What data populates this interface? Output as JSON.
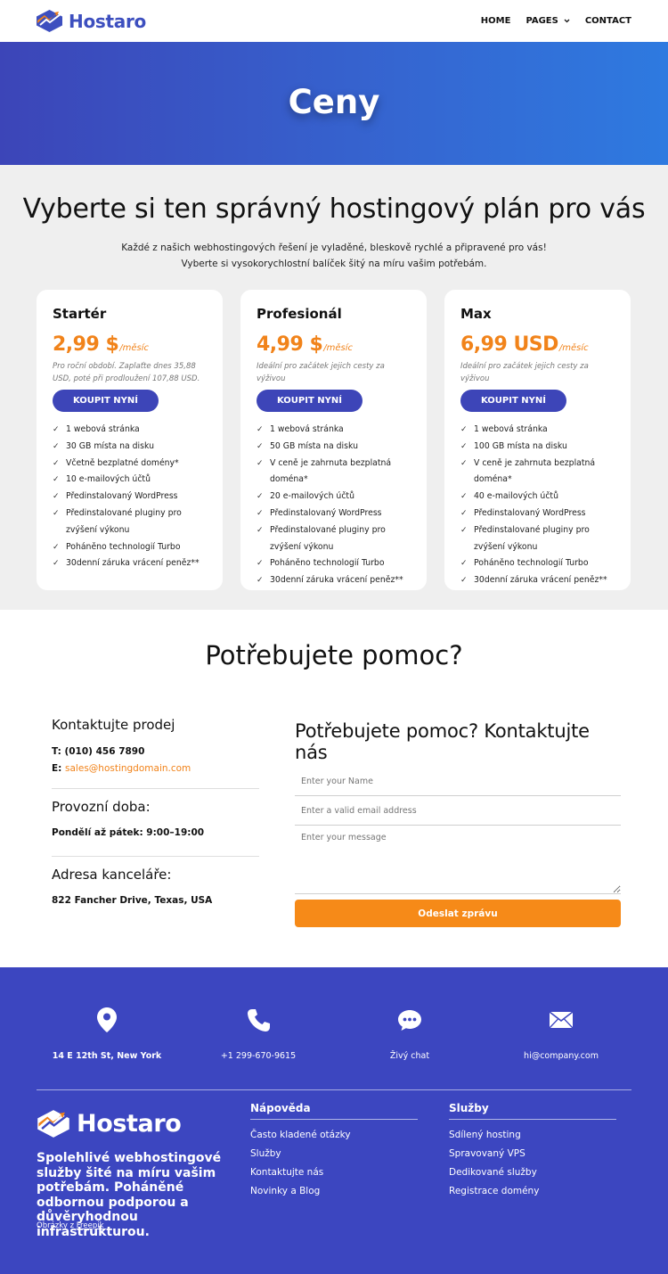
{
  "header": {
    "brand": "Hostaro",
    "nav": [
      "HOME",
      "PAGES",
      "CONTACT"
    ]
  },
  "hero": {
    "title": "Ceny"
  },
  "pricing": {
    "title": "Vyberte si ten správný hostingový plán pro vás",
    "intro_line1": "Každé z našich webhostingových řešení je vyladěné, bleskově rychlé a připravené pro vás!",
    "intro_line2": "Vyberte si vysokorychlostní balíček šitý na míru vašim potřebám.",
    "plans": [
      {
        "name": "Startér",
        "price": "2,99 $",
        "per": "/měsíc",
        "note": "Pro roční období. Zaplaťte dnes 35,88 USD, poté při prodloužení 107,88 USD.",
        "button": "KOUPIT NYNÍ",
        "features": [
          "1 webová stránka",
          "30 GB místa na disku",
          "Včetně bezplatné domény*",
          "10 e-mailových účtů",
          "Předinstalovaný WordPress",
          "Předinstalované pluginy pro zvýšení výkonu",
          "Poháněno technologií Turbo",
          "30denní záruka vrácení peněz**"
        ]
      },
      {
        "name": "Profesionál",
        "price": "4,99 $",
        "per": "/měsíc",
        "note": "Ideální pro začátek jejich cesty za výživou",
        "button": "KOUPIT NYNÍ",
        "features": [
          "1 webová stránka",
          "50 GB místa na disku",
          "V ceně je zahrnuta bezplatná doména*",
          "20 e-mailových účtů",
          "Předinstalovaný WordPress",
          "Předinstalované pluginy pro zvýšení výkonu",
          "Poháněno technologií Turbo",
          "30denní záruka vrácení peněz**"
        ]
      },
      {
        "name": "Max",
        "price": "6,99 USD",
        "per": "/měsíc",
        "note": "Ideální pro začátek jejich cesty za výživou",
        "button": "KOUPIT NYNÍ",
        "features": [
          "1 webová stránka",
          "100 GB místa na disku",
          "V ceně je zahrnuta bezplatná doména*",
          "40 e-mailových účtů",
          "Předinstalovaný WordPress",
          "Předinstalované pluginy pro zvýšení výkonu",
          "Poháněno technologií Turbo",
          "30denní záruka vrácení peněz**"
        ]
      }
    ]
  },
  "help": {
    "title": "Potřebujete pomoc?",
    "sales_heading": "Kontaktujte prodej",
    "phone_label": "T:",
    "phone": "(010) 456 7890",
    "email_label": "E:",
    "email": "sales@hostingdomain.com",
    "hours_heading": "Provozní doba:",
    "hours": "Pondělí až pátek: 9:00–19:00",
    "address_heading": "Adresa kanceláře:",
    "address": "822 Fancher Drive, Texas, USA",
    "form_title": "Potřebujete pomoc? Kontaktujte nás",
    "name_placeholder": "Enter your Name",
    "email_placeholder": "Enter a valid email address",
    "message_placeholder": "Enter your message",
    "send": "Odeslat zprávu"
  },
  "footer": {
    "contacts": [
      {
        "icon": "location-pin-icon",
        "text": "14 E 12th St, New York"
      },
      {
        "icon": "phone-icon",
        "text": "+1 299-670-9615"
      },
      {
        "icon": "chat-icon",
        "text": "Živý chat"
      },
      {
        "icon": "mail-icon",
        "text": "hi@company.com"
      }
    ],
    "brand": "Hostaro",
    "tagline": "Spolehlivé webhostingové služby šité na míru vašim potřebám. Poháněné odbornou podporou a důvěryhodnou infrastrukturou.",
    "credit_prefix": "Obrázky z",
    "credit_link": "Freepik",
    "help_heading": "Nápověda",
    "help_links": [
      "Často kladené otázky",
      "Služby",
      "Kontaktujte nás",
      "Novinky a Blog"
    ],
    "services_heading": "Služby",
    "services_links": [
      "Sdílený hosting",
      "Spravovaný VPS",
      "Dedikované služby",
      "Registrace domény"
    ]
  },
  "colors": {
    "brand_blue": "#3d45b8",
    "accent_orange": "#f1831a",
    "footer_bg": "#3c46c0"
  }
}
